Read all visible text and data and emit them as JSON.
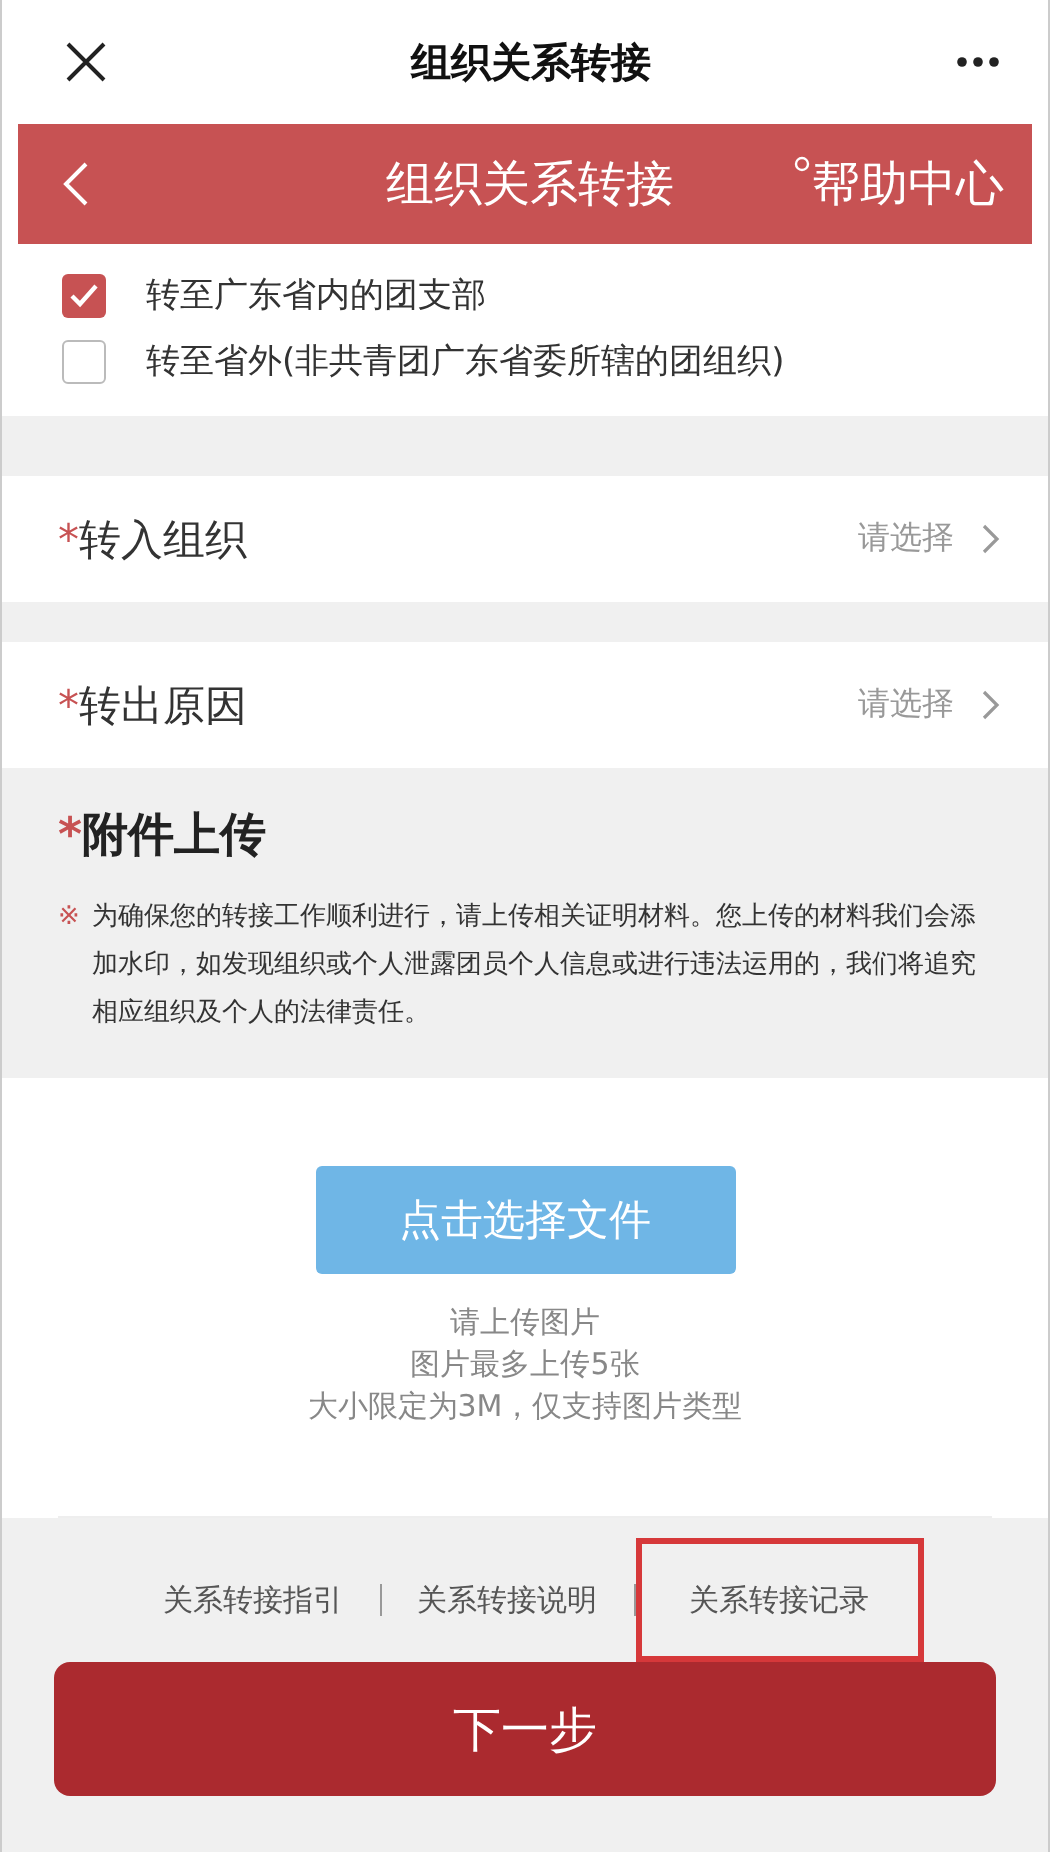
{
  "top_bar": {
    "title": "组织关系转接"
  },
  "header": {
    "title": "组织关系转接",
    "help": "帮助中心"
  },
  "options": [
    {
      "label": "转至广东省内的团支部",
      "checked": true
    },
    {
      "label": "转至省外(非共青团广东省委所辖的团组织)",
      "checked": false
    }
  ],
  "fields": [
    {
      "required_mark": "*",
      "label": "转入组织",
      "placeholder": "请选择"
    },
    {
      "required_mark": "*",
      "label": "转出原因",
      "placeholder": "请选择"
    }
  ],
  "attachment": {
    "required_mark": "*",
    "title": "附件上传",
    "note_mark": "※",
    "note": "为确保您的转接工作顺利进行，请上传相关证明材料。您上传的材料我们会添加水印，如发现组织或个人泄露团员个人信息或进行违法运用的，我们将追究相应组织及个人的法律责任。",
    "button": "点击选择文件",
    "hints": [
      "请上传图片",
      "图片最多上传5张",
      "大小限定为3M，仅支持图片类型"
    ]
  },
  "links": [
    {
      "label": "关系转接指引",
      "highlighted": false
    },
    {
      "label": "关系转接说明",
      "highlighted": false
    },
    {
      "label": "关系转接记录",
      "highlighted": true
    }
  ],
  "next_button": "下一步"
}
